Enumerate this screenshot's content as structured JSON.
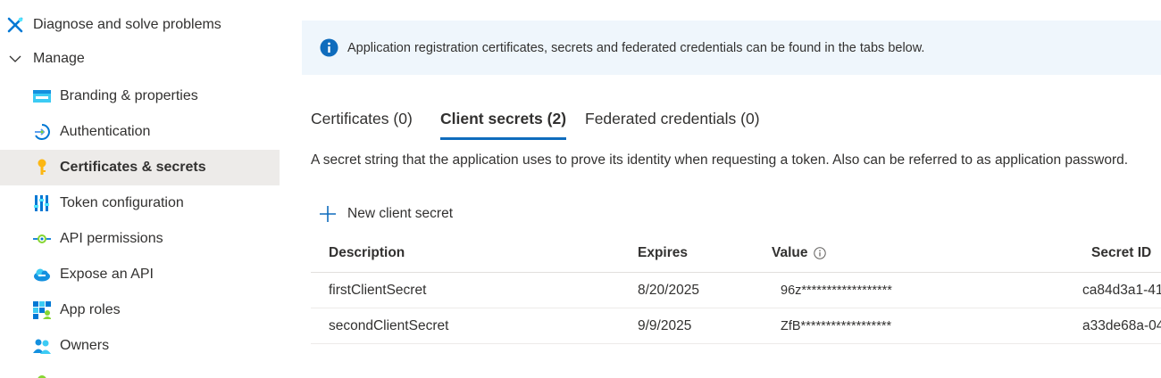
{
  "sidebar": {
    "top_items": [
      {
        "label": "Diagnose and solve problems",
        "icon": "wrench-icon"
      },
      {
        "label": "Manage",
        "icon": "chevron-down-icon"
      }
    ],
    "items": [
      {
        "label": "Branding & properties",
        "icon": "branding-icon"
      },
      {
        "label": "Authentication",
        "icon": "authentication-icon"
      },
      {
        "label": "Certificates & secrets",
        "icon": "key-icon",
        "active": true
      },
      {
        "label": "Token configuration",
        "icon": "token-icon"
      },
      {
        "label": "API permissions",
        "icon": "api-permissions-icon"
      },
      {
        "label": "Expose an API",
        "icon": "cloud-icon"
      },
      {
        "label": "App roles",
        "icon": "app-roles-icon"
      },
      {
        "label": "Owners",
        "icon": "owners-icon"
      }
    ]
  },
  "info_bar": {
    "text": "Application registration certificates, secrets and federated credentials can be found in the tabs below.",
    "icon": "info-icon"
  },
  "tabs": [
    {
      "label": "Certificates (0)",
      "active": false
    },
    {
      "label": "Client secrets (2)",
      "active": true
    },
    {
      "label": "Federated credentials (0)",
      "active": false
    }
  ],
  "description": "A secret string that the application uses to prove its identity when requesting a token. Also can be referred to as application password.",
  "new_button": {
    "label": "New client secret",
    "icon": "plus-icon"
  },
  "table": {
    "headers": [
      "Description",
      "Expires",
      "Value",
      "Secret ID"
    ],
    "rows": [
      {
        "description": "firstClientSecret",
        "expires": "8/20/2025",
        "value": "96z******************",
        "secret_id": "ca84d3a1-41"
      },
      {
        "description": "secondClientSecret",
        "expires": "9/9/2025",
        "value": "ZfB******************",
        "secret_id": "a33de68a-04"
      }
    ]
  },
  "colors": {
    "accent": "#0f6cbd",
    "info_bg": "#eff6fc",
    "active_nav_bg": "#edebe9"
  }
}
